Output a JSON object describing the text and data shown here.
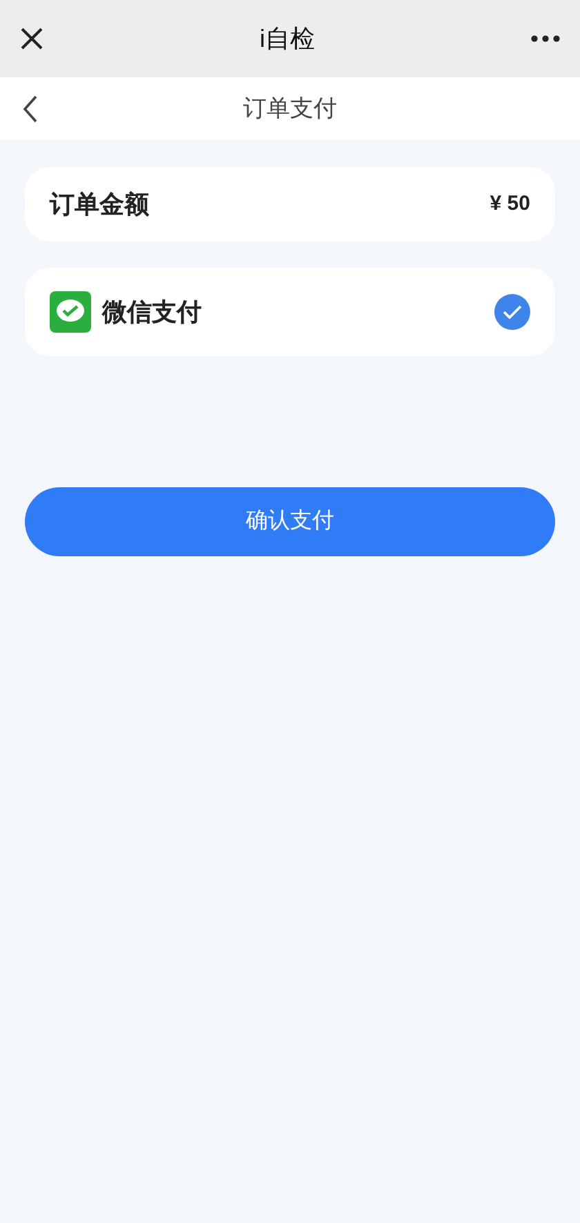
{
  "window": {
    "title": "i自检"
  },
  "page": {
    "title": "订单支付"
  },
  "order": {
    "label": "订单金额",
    "amount": "¥ 50"
  },
  "payment_methods": [
    {
      "label": "微信支付",
      "selected": true
    }
  ],
  "confirm_button": "确认支付"
}
